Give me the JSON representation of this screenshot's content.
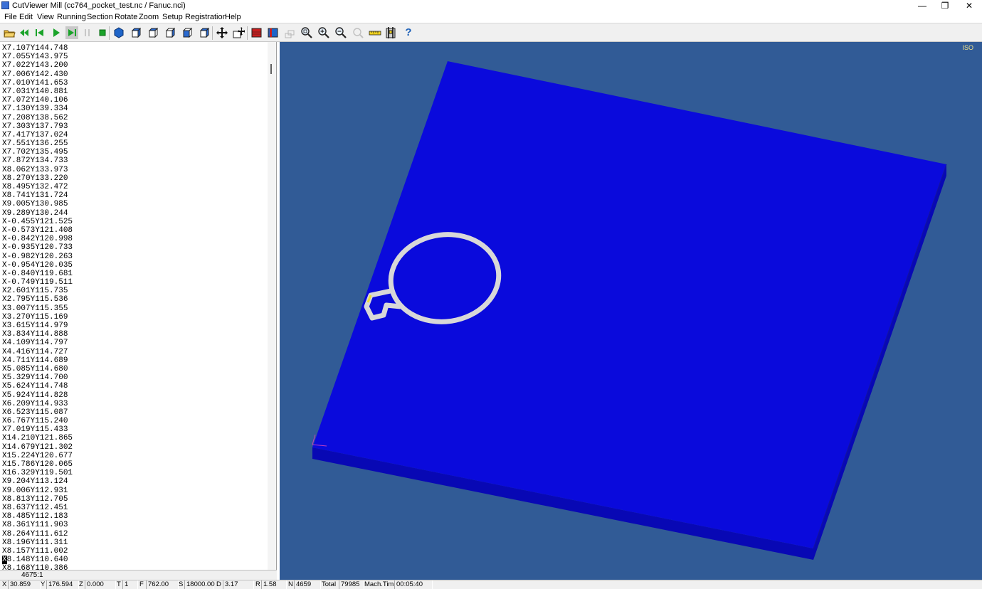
{
  "window": {
    "title": "CutViewer Mill (cc764_pocket_test.nc / Fanuc.nci)",
    "minimize_glyph": "—",
    "restore_glyph": "❐",
    "close_glyph": "✕"
  },
  "menu": [
    "File",
    "Edit",
    "View",
    "Running",
    "Section",
    "Rotate",
    "Zoom",
    "Setup",
    "Registration",
    "Help"
  ],
  "toolbar": {
    "icons": [
      "open-folder-icon",
      "rewind-icon",
      "step-back-icon",
      "play-icon",
      "step-forward-icon",
      "pause-icon",
      "stop-icon",
      "iso-view-icon",
      "front-view-icon",
      "back-view-icon",
      "right-view-icon",
      "left-view-icon",
      "top-view-icon",
      "pan-icon",
      "move-stock-icon",
      "section-red-icon",
      "section-blue-icon",
      "section-disabled-icon",
      "zoom-window-icon",
      "zoom-in-icon",
      "zoom-out-icon",
      "undo-zoom-icon",
      "measure-ruler-icon",
      "tool-setup-icon",
      "help-icon"
    ],
    "help_glyph": "?"
  },
  "code": {
    "lines": [
      "X7.107Y144.748",
      "X7.055Y143.975",
      "X7.022Y143.200",
      "X7.006Y142.430",
      "X7.010Y141.653",
      "X7.031Y140.881",
      "X7.072Y140.106",
      "X7.130Y139.334",
      "X7.208Y138.562",
      "X7.303Y137.793",
      "X7.417Y137.024",
      "X7.551Y136.255",
      "X7.702Y135.495",
      "X7.872Y134.733",
      "X8.062Y133.973",
      "X8.270Y133.220",
      "X8.495Y132.472",
      "X8.741Y131.724",
      "X9.005Y130.985",
      "X9.289Y130.244",
      "X-0.455Y121.525",
      "X-0.573Y121.408",
      "X-0.842Y120.998",
      "X-0.935Y120.733",
      "X-0.982Y120.263",
      "X-0.954Y120.035",
      "X-0.840Y119.681",
      "X-0.749Y119.511",
      "X2.601Y115.735",
      "X2.795Y115.536",
      "X3.007Y115.355",
      "X3.270Y115.169",
      "X3.615Y114.979",
      "X3.834Y114.888",
      "X4.109Y114.797",
      "X4.416Y114.727",
      "X4.711Y114.689",
      "X5.085Y114.680",
      "X5.329Y114.700",
      "X5.624Y114.748",
      "X5.924Y114.828",
      "X6.209Y114.933",
      "X6.523Y115.087",
      "X6.767Y115.240",
      "X7.019Y115.433",
      "X14.210Y121.865",
      "X14.679Y121.302",
      "X15.224Y120.677",
      "X15.786Y120.065",
      "X16.329Y119.501",
      "X9.204Y113.124",
      "X9.006Y112.931",
      "X8.813Y112.705",
      "X8.637Y112.451",
      "X8.485Y112.183",
      "X8.361Y111.903",
      "X8.264Y111.612",
      "X8.196Y111.311",
      "X8.157Y111.002",
      "X8.148Y110.640",
      "X8.168Y110.386"
    ],
    "current_line_index": 59,
    "line_number": "4675:1"
  },
  "viewport": {
    "view_label": "ISO",
    "background_color": "#315b96",
    "stock_color": "#0a0adc",
    "stock_side_color": "#0808b4",
    "cut_color": "#d8d8d8"
  },
  "status": {
    "x_label": "X",
    "x_value": "30.859",
    "y_label": "Y",
    "y_value": "176.594",
    "z_label": "Z",
    "z_value": "0.000",
    "t_label": "T",
    "t_value": "1",
    "f_label": "F",
    "f_value": "762.00",
    "s_label": "S",
    "s_value": "18000.00",
    "d_label": "D",
    "d_value": "3.17",
    "r_label": "R",
    "r_value": "1.58",
    "n_label": "N",
    "n_value": "4659",
    "total_label": "Total",
    "total_value": "79985",
    "mach_label": "Mach.Tim",
    "mach_value": "00:05:40"
  }
}
